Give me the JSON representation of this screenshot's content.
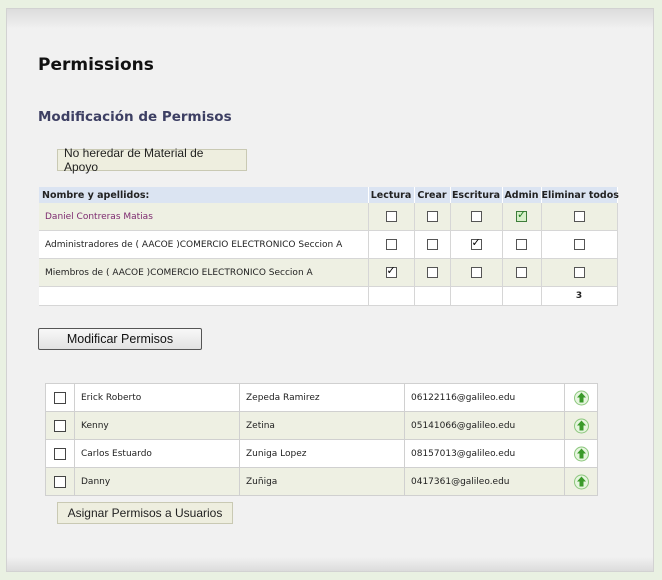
{
  "page": {
    "title": "Permissions",
    "subtitle": "Modificación de Permisos",
    "inherit_button": "No heredar de Material de Apoyo",
    "modify_button": "Modificar Permisos",
    "assign_button": "Asignar Permisos a Usuarios"
  },
  "permissions": {
    "headers": [
      "Nombre y apellidos:",
      "Lectura",
      "Crear",
      "Escritura",
      "Admin",
      "Eliminar todos"
    ],
    "rows": [
      {
        "name": "Daniel Contreras Matias",
        "lectura": false,
        "crear": false,
        "escritura": false,
        "admin": true,
        "eliminar": false
      },
      {
        "name": "Administradores de ( AACOE )COMERCIO ELECTRONICO Seccion A",
        "lectura": false,
        "crear": false,
        "escritura": true,
        "admin": false,
        "eliminar": false
      },
      {
        "name": "Miembros de ( AACOE )COMERCIO ELECTRONICO Seccion A",
        "lectura": true,
        "crear": false,
        "escritura": false,
        "admin": false,
        "eliminar": false
      }
    ],
    "footer_value": "3"
  },
  "users": [
    {
      "first": "Erick Roberto",
      "last": "Zepeda Ramirez",
      "email": "06122116@galileo.edu"
    },
    {
      "first": "Kenny",
      "last": "Zetina",
      "email": "05141066@galileo.edu"
    },
    {
      "first": "Carlos Estuardo",
      "last": "Zuniga Lopez",
      "email": "08157013@galileo.edu"
    },
    {
      "first": "Danny",
      "last": "Zuñiga",
      "email": "0417361@galileo.edu"
    }
  ],
  "icons": {
    "checkbox": "checkbox-icon",
    "checkmark": "checkmark-icon",
    "assign": "green-up-arrow-icon"
  },
  "colors": {
    "header_bg": "#dbe4f2",
    "alt_row": "#eef0e3",
    "subtitle": "#3d3f63",
    "link_name": "#7d2a6f",
    "arrow_green": "#3a9a2a"
  }
}
